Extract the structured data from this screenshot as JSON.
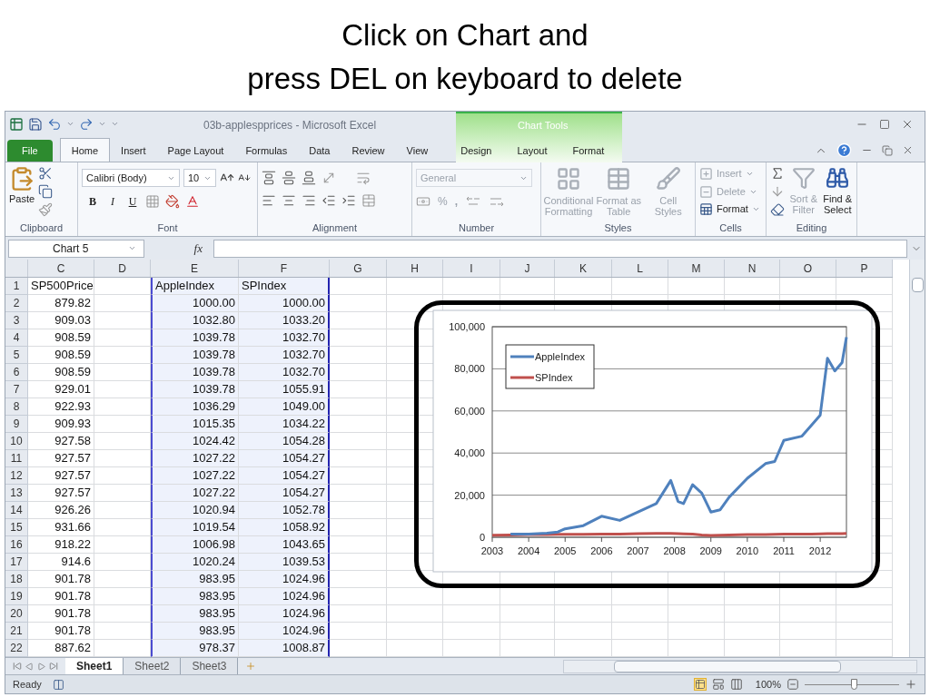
{
  "slide": {
    "title_lines": [
      "Click on Chart and",
      "press DEL on keyboard to delete"
    ]
  },
  "window": {
    "title": "03b-applespprices - Microsoft Excel",
    "context_group": "Chart Tools"
  },
  "tabs": [
    {
      "label": "File",
      "kind": "file",
      "selected": false
    },
    {
      "label": "Home",
      "kind": "normal",
      "selected": true
    },
    {
      "label": "Insert",
      "kind": "normal",
      "selected": false
    },
    {
      "label": "Page Layout",
      "kind": "normal",
      "selected": false
    },
    {
      "label": "Formulas",
      "kind": "normal",
      "selected": false
    },
    {
      "label": "Data",
      "kind": "normal",
      "selected": false
    },
    {
      "label": "Review",
      "kind": "normal",
      "selected": false
    },
    {
      "label": "View",
      "kind": "normal",
      "selected": false
    },
    {
      "label": "Design",
      "kind": "context",
      "selected": false
    },
    {
      "label": "Layout",
      "kind": "context",
      "selected": false
    },
    {
      "label": "Format",
      "kind": "context",
      "selected": false
    }
  ],
  "ribbon": {
    "clipboard": {
      "label": "Clipboard",
      "paste": "Paste"
    },
    "font": {
      "label": "Font",
      "face": "Calibri (Body)",
      "size": "10",
      "style_buttons": [
        "B",
        "I",
        "U"
      ]
    },
    "alignment": {
      "label": "Alignment"
    },
    "number": {
      "label": "Number",
      "format": "General",
      "percent": "%",
      "comma": ",",
      "disabled": true
    },
    "styles": {
      "label": "Styles",
      "buttons": [
        {
          "label": "Conditional Formatting",
          "disabled": true
        },
        {
          "label": "Format as Table",
          "disabled": true
        },
        {
          "label": "Cell Styles",
          "disabled": true
        }
      ]
    },
    "cells": {
      "label": "Cells",
      "buttons": [
        {
          "label": "Insert",
          "disabled": true
        },
        {
          "label": "Delete",
          "disabled": true
        },
        {
          "label": "Format",
          "disabled": false
        }
      ]
    },
    "editing": {
      "label": "Editing",
      "buttons": [
        {
          "label": "Sort & Filter",
          "disabled": true
        },
        {
          "label": "Find & Select",
          "disabled": false
        }
      ]
    }
  },
  "formula_bar": {
    "name_box": "Chart 5",
    "function_label": "fx"
  },
  "sheet": {
    "columns": [
      {
        "letter": "C",
        "in_selection": false
      },
      {
        "letter": "D",
        "in_selection": false
      },
      {
        "letter": "E",
        "in_selection": true
      },
      {
        "letter": "F",
        "in_selection": true
      },
      {
        "letter": "G",
        "in_selection": false
      },
      {
        "letter": "H",
        "in_selection": false
      },
      {
        "letter": "I",
        "in_selection": false
      },
      {
        "letter": "J",
        "in_selection": false
      },
      {
        "letter": "K",
        "in_selection": false
      },
      {
        "letter": "L",
        "in_selection": false
      },
      {
        "letter": "M",
        "in_selection": false
      },
      {
        "letter": "N",
        "in_selection": false
      },
      {
        "letter": "O",
        "in_selection": false
      },
      {
        "letter": "P",
        "in_selection": false
      }
    ],
    "rows": [
      {
        "number": "1",
        "kind": "text",
        "cells": {
          "C": "SP500Price",
          "E": "AppleIndex",
          "F": "SPIndex"
        }
      },
      {
        "number": "2",
        "kind": "number",
        "cells": {
          "C": "879.82",
          "E": "1000.00",
          "F": "1000.00"
        }
      },
      {
        "number": "3",
        "kind": "number",
        "cells": {
          "C": "909.03",
          "E": "1032.80",
          "F": "1033.20"
        }
      },
      {
        "number": "4",
        "kind": "number",
        "cells": {
          "C": "908.59",
          "E": "1039.78",
          "F": "1032.70"
        }
      },
      {
        "number": "5",
        "kind": "number",
        "cells": {
          "C": "908.59",
          "E": "1039.78",
          "F": "1032.70"
        }
      },
      {
        "number": "6",
        "kind": "number",
        "cells": {
          "C": "908.59",
          "E": "1039.78",
          "F": "1032.70"
        }
      },
      {
        "number": "7",
        "kind": "number",
        "cells": {
          "C": "929.01",
          "E": "1039.78",
          "F": "1055.91"
        }
      },
      {
        "number": "8",
        "kind": "number",
        "cells": {
          "C": "922.93",
          "E": "1036.29",
          "F": "1049.00"
        }
      },
      {
        "number": "9",
        "kind": "number",
        "cells": {
          "C": "909.93",
          "E": "1015.35",
          "F": "1034.22"
        }
      },
      {
        "number": "10",
        "kind": "number",
        "cells": {
          "C": "927.58",
          "E": "1024.42",
          "F": "1054.28"
        }
      },
      {
        "number": "11",
        "kind": "number",
        "cells": {
          "C": "927.57",
          "E": "1027.22",
          "F": "1054.27"
        }
      },
      {
        "number": "12",
        "kind": "number",
        "cells": {
          "C": "927.57",
          "E": "1027.22",
          "F": "1054.27"
        }
      },
      {
        "number": "13",
        "kind": "number",
        "cells": {
          "C": "927.57",
          "E": "1027.22",
          "F": "1054.27"
        }
      },
      {
        "number": "14",
        "kind": "number",
        "cells": {
          "C": "926.26",
          "E": "1020.94",
          "F": "1052.78"
        }
      },
      {
        "number": "15",
        "kind": "number",
        "cells": {
          "C": "931.66",
          "E": "1019.54",
          "F": "1058.92"
        }
      },
      {
        "number": "16",
        "kind": "number",
        "cells": {
          "C": "918.22",
          "E": "1006.98",
          "F": "1043.65"
        }
      },
      {
        "number": "17",
        "kind": "number",
        "cells": {
          "C": "914.6",
          "E": "1020.24",
          "F": "1039.53"
        }
      },
      {
        "number": "18",
        "kind": "number",
        "cells": {
          "C": "901.78",
          "E": "983.95",
          "F": "1024.96"
        }
      },
      {
        "number": "19",
        "kind": "number",
        "cells": {
          "C": "901.78",
          "E": "983.95",
          "F": "1024.96"
        }
      },
      {
        "number": "20",
        "kind": "number",
        "cells": {
          "C": "901.78",
          "E": "983.95",
          "F": "1024.96"
        }
      },
      {
        "number": "21",
        "kind": "number",
        "cells": {
          "C": "901.78",
          "E": "983.95",
          "F": "1024.96"
        }
      },
      {
        "number": "22",
        "kind": "number",
        "cells": {
          "C": "887.62",
          "E": "978.37",
          "F": "1008.87"
        }
      }
    ]
  },
  "chart": {
    "chart_data": {
      "type": "line",
      "x": [
        2003,
        2003.5,
        2004,
        2004.5,
        2004.8,
        2005,
        2005.5,
        2006,
        2006.5,
        2007,
        2007.5,
        2007.9,
        2008.1,
        2008.25,
        2008.5,
        2008.75,
        2009,
        2009.25,
        2009.5,
        2010,
        2010.5,
        2010.75,
        2011,
        2011.5,
        2011.75,
        2012,
        2012.2,
        2012.4,
        2012.6,
        2012.72
      ],
      "series": [
        {
          "name": "AppleIndex",
          "color": "#4f81bd",
          "values": [
            null,
            1500,
            1500,
            2000,
            2500,
            4000,
            5500,
            10000,
            8000,
            12000,
            16000,
            27000,
            17000,
            16000,
            25000,
            21000,
            12000,
            13000,
            19000,
            28000,
            35000,
            36000,
            46000,
            48000,
            53000,
            58000,
            85000,
            79000,
            83000,
            95000
          ]
        },
        {
          "name": "SPIndex",
          "color": "#c0504d",
          "values": [
            1000,
            1100,
            1300,
            1300,
            1400,
            1400,
            1400,
            1500,
            1500,
            1700,
            1800,
            1800,
            1700,
            1600,
            1500,
            1100,
            900,
            1000,
            1100,
            1300,
            1300,
            1400,
            1500,
            1500,
            1500,
            1600,
            1700,
            1700,
            1700,
            1800
          ]
        }
      ],
      "grid": {
        "y": true
      },
      "legend": true,
      "xlim": [
        2003,
        2012.72
      ],
      "ylim": [
        0,
        100000
      ],
      "xticks": [
        2003,
        2004,
        2005,
        2006,
        2007,
        2008,
        2009,
        2010,
        2011,
        2012
      ],
      "yticks": [
        {
          "value": 0,
          "label": "0"
        },
        {
          "value": 20000,
          "label": "20,000"
        },
        {
          "value": 40000,
          "label": "40,000"
        },
        {
          "value": 60000,
          "label": "60,000"
        },
        {
          "value": 80000,
          "label": "80,000"
        },
        {
          "value": 100000,
          "label": "100,000"
        }
      ]
    }
  },
  "sheet_tabs": [
    {
      "label": "Sheet1",
      "selected": true
    },
    {
      "label": "Sheet2",
      "selected": false
    },
    {
      "label": "Sheet3",
      "selected": false
    }
  ],
  "status_bar": {
    "status": "Ready",
    "zoom": "100%",
    "zoom_level": {
      "level": 0.53
    }
  }
}
